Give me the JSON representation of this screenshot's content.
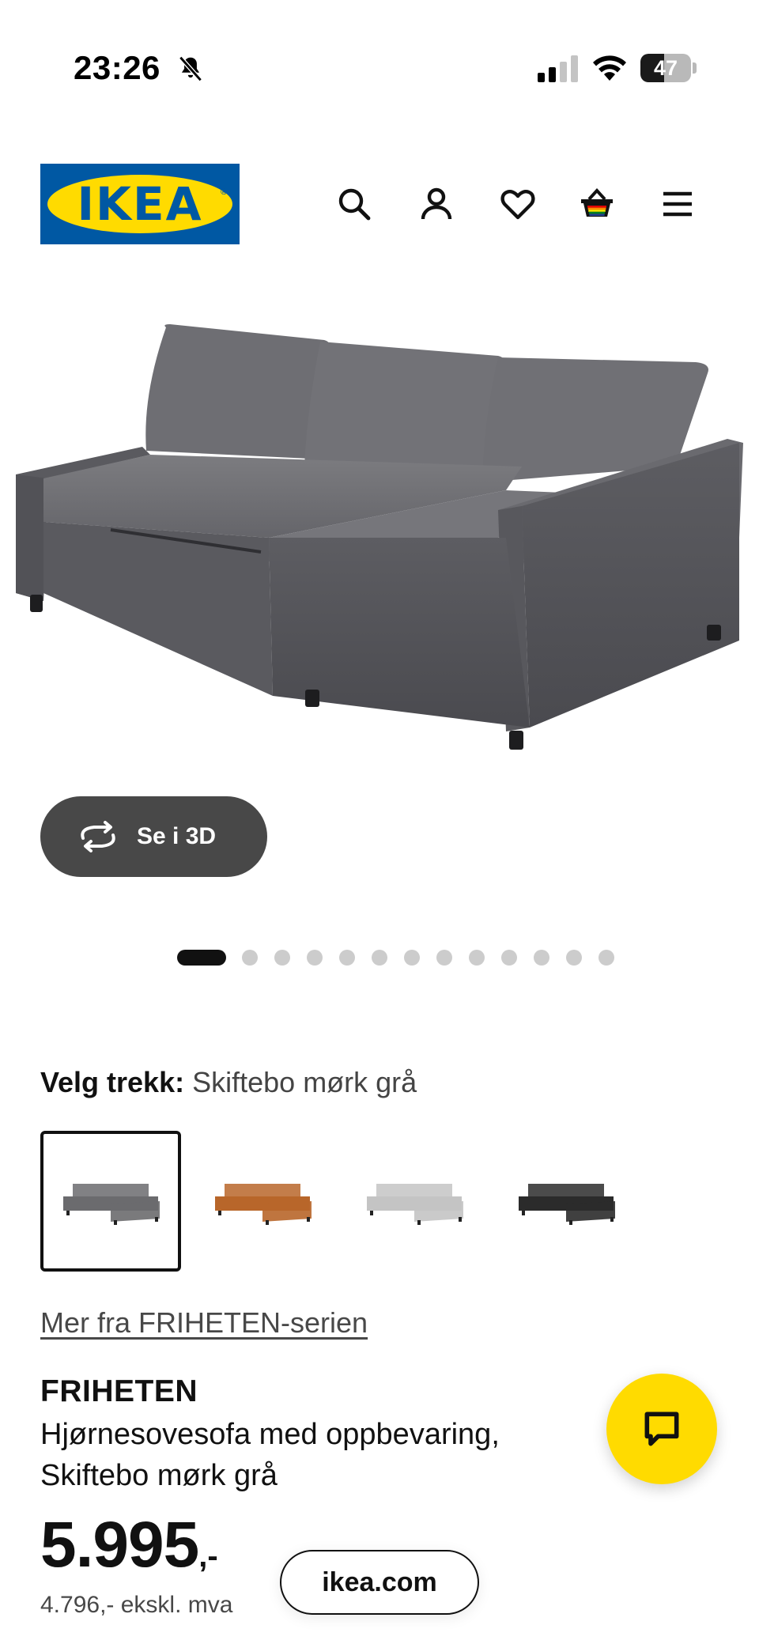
{
  "status_bar": {
    "time": "23:26",
    "battery_level": "47",
    "battery_fraction": 0.47
  },
  "header": {
    "logo_text": "IKEA",
    "logo_registered": "®",
    "icons": [
      "search-icon",
      "account-icon",
      "heart-icon",
      "basket-icon",
      "menu-icon"
    ]
  },
  "gallery": {
    "see_3d_label": "Se i 3D",
    "page_count": 13,
    "active_page": 1
  },
  "variant": {
    "label": "Velg trekk:",
    "value": "Skiftebo mørk grå",
    "options": [
      {
        "name": "Skiftebo mørk grå",
        "color": "#6b6b6e",
        "selected": true
      },
      {
        "name": "orange",
        "color": "#b8662a",
        "selected": false
      },
      {
        "name": "lys grå",
        "color": "#c4c4c4",
        "selected": false
      },
      {
        "name": "svart",
        "color": "#2b2b2b",
        "selected": false
      }
    ]
  },
  "series_link": "Mer fra FRIHETEN-serien",
  "product": {
    "name": "FRIHETEN",
    "description": "Hjørnesovesofa med oppbevaring, Skiftebo mørk grå",
    "price": "5.995",
    "price_suffix": ",-",
    "price_ex_vat": "4.796,- ekskl. mva"
  },
  "browser": {
    "domain": "ikea.com"
  },
  "colors": {
    "ikea_blue": "#0058a3",
    "ikea_yellow": "#ffdb00",
    "button_dark": "#484848",
    "sofa_gray": "#6b6b6e"
  }
}
